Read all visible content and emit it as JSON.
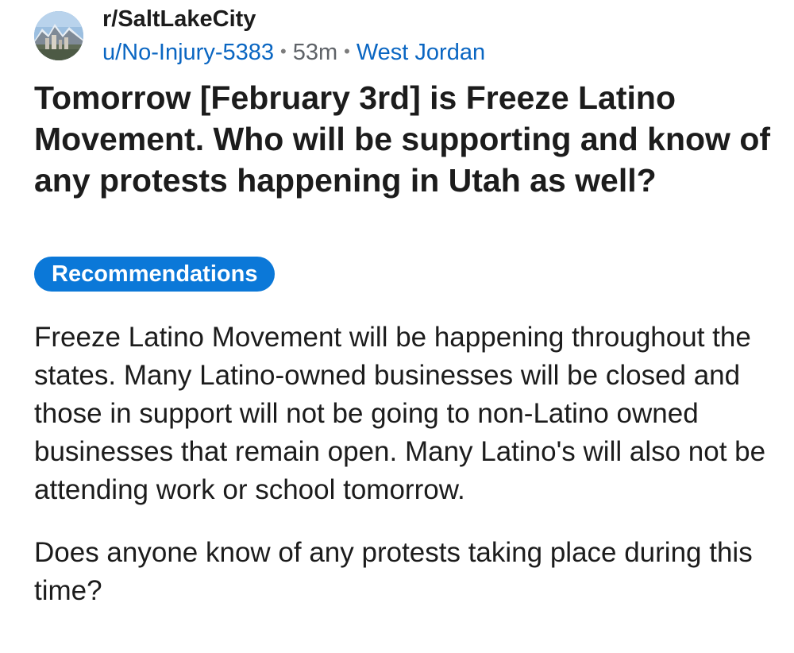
{
  "post": {
    "subreddit": "r/SaltLakeCity",
    "author": "u/No-Injury-5383",
    "separator": "•",
    "age": "53m",
    "location": "West Jordan",
    "title": "Tomorrow [February 3rd] is Freeze Latino Movement. Who will be supporting and know of any protests happening in Utah as well?",
    "flair": "Recommendations",
    "body": [
      "Freeze Latino Movement will be happening throughout the states. Many Latino-owned businesses will be closed and those in support will not be going to non-Latino owned businesses that remain open. Many Latino's will also not be attending work or school tomorrow.",
      "Does anyone know of any protests taking place during this time?"
    ],
    "colors": {
      "link": "#0a66c2",
      "flair_background": "#0b78d8",
      "flair_text": "#ffffff",
      "text": "#1c1c1c",
      "muted": "#5f6368"
    },
    "avatar_icon": "mountain-city-icon"
  }
}
